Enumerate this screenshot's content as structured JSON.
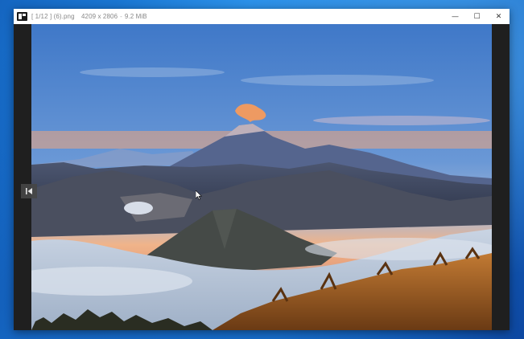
{
  "window": {
    "counter": "[ 1/12 ]",
    "filename": "(6).png",
    "dimensions": "4209 x 2806",
    "dash": "-",
    "filesize": "9.2 MiB"
  },
  "controls": {
    "minimize": "—",
    "maximize": "☐",
    "close": "✕"
  },
  "icons": {
    "app": "image-viewer-app-icon",
    "prev": "previous-image-icon",
    "cursor": "mouse-pointer-icon"
  },
  "colors": {
    "titlebar": "#ffffff",
    "viewer_background": "#1f1f1f",
    "desktop": "#1e88e5"
  }
}
